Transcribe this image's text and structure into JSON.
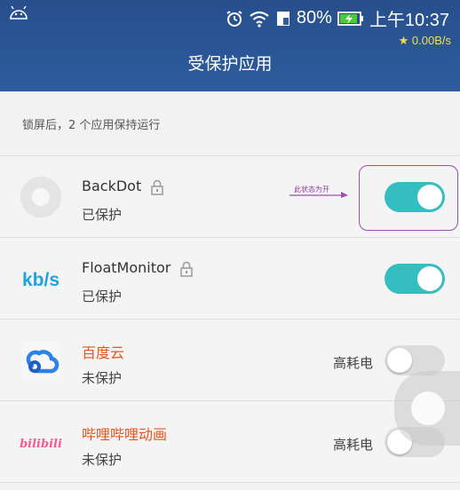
{
  "status_bar": {
    "battery": "80%",
    "time": "上午10:37",
    "speed": "★ 0.00B/s"
  },
  "header": {
    "title": "受保护应用"
  },
  "info": {
    "text": "锁屏后，2 个应用保持运行"
  },
  "annotation": {
    "text": "此状态为开"
  },
  "apps": [
    {
      "name": "BackDot",
      "status": "已保护",
      "power_label": "",
      "toggle": "on",
      "locked": true
    },
    {
      "name": "FloatMonitor",
      "status": "已保护",
      "power_label": "",
      "toggle": "on",
      "locked": true,
      "icon_text": "kb/s"
    },
    {
      "name": "百度云",
      "status": "未保护",
      "power_label": "高耗电",
      "toggle": "off",
      "locked": false
    },
    {
      "name": "哔哩哔哩动画",
      "status": "未保护",
      "power_label": "高耗电",
      "toggle": "off",
      "locked": false,
      "icon_text": "bilibili"
    }
  ],
  "colors": {
    "header": "#2d5c9e",
    "toggle_on": "#34bec0",
    "toggle_off": "#dcdcdc",
    "warning_app": "#e8541e",
    "annotation": "#9b4fb0"
  }
}
